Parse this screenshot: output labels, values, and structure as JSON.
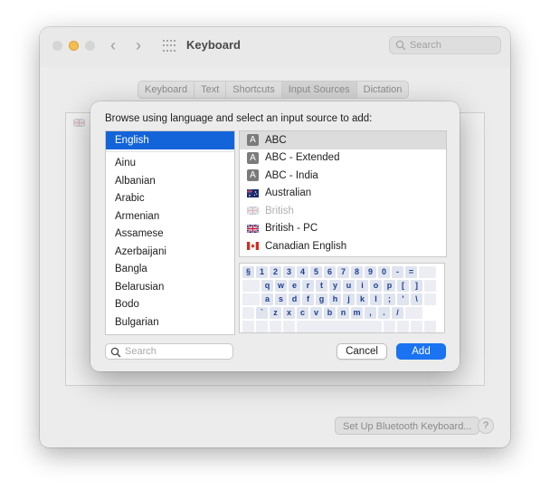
{
  "window": {
    "title": "Keyboard",
    "search_placeholder": "Search",
    "tabs": [
      "Keyboard",
      "Text",
      "Shortcuts",
      "Input Sources",
      "Dictation"
    ],
    "active_tab": "Input Sources",
    "bluetooth_button": "Set Up Bluetooth Keyboard...",
    "help_label": "?",
    "add_label": "+"
  },
  "sheet": {
    "prompt": "Browse using language and select an input source to add:",
    "selected_language": "English",
    "languages": [
      "Ainu",
      "Albanian",
      "Arabic",
      "Armenian",
      "Assamese",
      "Azerbaijani",
      "Bangla",
      "Belarusian",
      "Bodo",
      "Bulgarian"
    ],
    "sources": [
      {
        "label": "ABC",
        "icon": "letter-a-icon",
        "selected": true,
        "dim": false
      },
      {
        "label": "ABC - Extended",
        "icon": "letter-a-icon",
        "selected": false,
        "dim": false
      },
      {
        "label": "ABC - India",
        "icon": "letter-a-icon",
        "selected": false,
        "dim": false
      },
      {
        "label": "Australian",
        "icon": "australia-flag-icon",
        "selected": false,
        "dim": false
      },
      {
        "label": "British",
        "icon": "uk-flag-icon",
        "selected": false,
        "dim": true
      },
      {
        "label": "British - PC",
        "icon": "uk-flag-icon",
        "selected": false,
        "dim": false
      },
      {
        "label": "Canadian English",
        "icon": "canada-flag-icon",
        "selected": false,
        "dim": false
      }
    ],
    "keyboard_rows": [
      [
        "§",
        "1",
        "2",
        "3",
        "4",
        "5",
        "6",
        "7",
        "8",
        "9",
        "0",
        "-",
        "="
      ],
      [
        "q",
        "w",
        "e",
        "r",
        "t",
        "y",
        "u",
        "i",
        "o",
        "p",
        "[",
        "]"
      ],
      [
        "a",
        "s",
        "d",
        "f",
        "g",
        "h",
        "j",
        "k",
        "l",
        ";",
        "'",
        "\\"
      ],
      [
        "`",
        "z",
        "x",
        "c",
        "v",
        "b",
        "n",
        "m",
        ",",
        ".",
        "/"
      ]
    ],
    "search_placeholder": "Search",
    "cancel_label": "Cancel",
    "add_label": "Add"
  },
  "colors": {
    "accent": "#1a73f0",
    "selection": "#1464d9",
    "key_text": "#1f3f8f"
  }
}
